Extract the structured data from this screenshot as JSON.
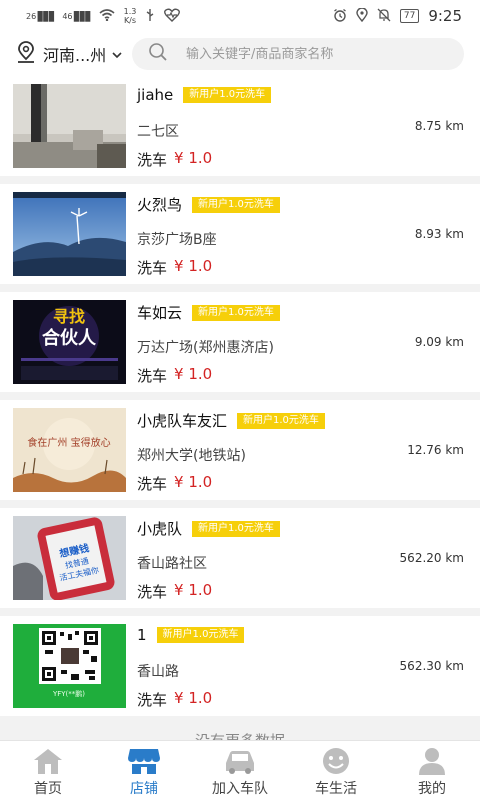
{
  "status_bar": {
    "network1": "26",
    "network2": "46",
    "speed_value": "1.3",
    "speed_unit": "K/s",
    "battery": "77",
    "time": "9:25"
  },
  "header": {
    "city": "河南...州",
    "search_placeholder": "输入关键字/商品商家名称"
  },
  "shops": [
    {
      "name": "jiahe",
      "badge": "新用户1.0元洗车",
      "address": "二七区",
      "distance": "8.75 km",
      "service": "洗车",
      "price": "¥ 1.0"
    },
    {
      "name": "火烈鸟",
      "badge": "新用户1.0元洗车",
      "address": "京莎广场B座",
      "distance": "8.93 km",
      "service": "洗车",
      "price": "¥ 1.0"
    },
    {
      "name": "车如云",
      "badge": "新用户1.0元洗车",
      "address": "万达广场(郑州惠济店)",
      "distance": "9.09 km",
      "service": "洗车",
      "price": "¥ 1.0"
    },
    {
      "name": "小虎队车友汇",
      "badge": "新用户1.0元洗车",
      "address": "郑州大学(地铁站)",
      "distance": "12.76 km",
      "service": "洗车",
      "price": "¥ 1.0"
    },
    {
      "name": "小虎队",
      "badge": "新用户1.0元洗车",
      "address": "香山路社区",
      "distance": "562.20 km",
      "service": "洗车",
      "price": "¥ 1.0"
    },
    {
      "name": "1",
      "badge": "新用户1.0元洗车",
      "address": "香山路",
      "distance": "562.30 km",
      "service": "洗车",
      "price": "¥ 1.0"
    }
  ],
  "thumbs": {
    "t3_line1": "寻找",
    "t3_line2": "合伙人",
    "t4_text": "食在广州 宝得放心",
    "t5_line1": "想赚钱",
    "t5_line2": "找普通",
    "t5_line3": "活工夫福你",
    "t6_caption": "YFY(**鹏)"
  },
  "footer": {
    "no_more": "没有更多数据"
  },
  "tabs": [
    {
      "label": "首页"
    },
    {
      "label": "店铺"
    },
    {
      "label": "加入车队"
    },
    {
      "label": "车生活"
    },
    {
      "label": "我的"
    }
  ],
  "colors": {
    "accent": "#2a7cc9",
    "badge": "#f6cf0a",
    "price": "#d32323"
  }
}
